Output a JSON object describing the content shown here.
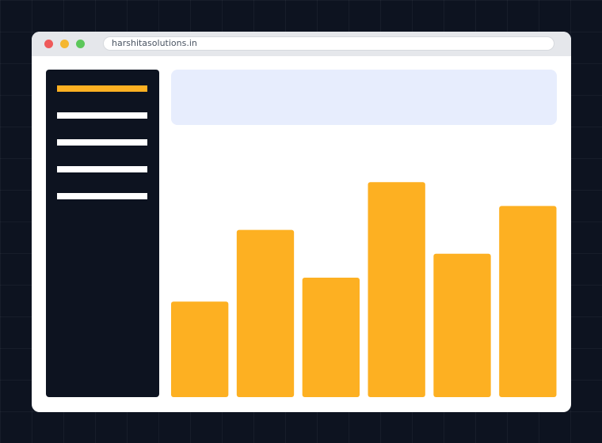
{
  "browser": {
    "url": "harshitasolutions.in",
    "controls": [
      {
        "name": "close",
        "color": "#ef5a5a"
      },
      {
        "name": "minimize",
        "color": "#f5b731"
      },
      {
        "name": "maximize",
        "color": "#5cc75a"
      }
    ]
  },
  "sidebar": {
    "background": "#0d1320",
    "items": [
      {
        "state": "active",
        "color": "#fdb022"
      },
      {
        "state": "inactive",
        "color": "#ffffff"
      },
      {
        "state": "inactive",
        "color": "#ffffff"
      },
      {
        "state": "inactive",
        "color": "#ffffff"
      },
      {
        "state": "inactive",
        "color": "#ffffff"
      }
    ]
  },
  "header_card": {
    "background": "#e7edfd"
  },
  "chart_data": {
    "type": "bar",
    "values": [
      40,
      70,
      50,
      90,
      60,
      80
    ],
    "ylim": [
      0,
      100
    ],
    "grid": false,
    "color": "#fdb022"
  }
}
